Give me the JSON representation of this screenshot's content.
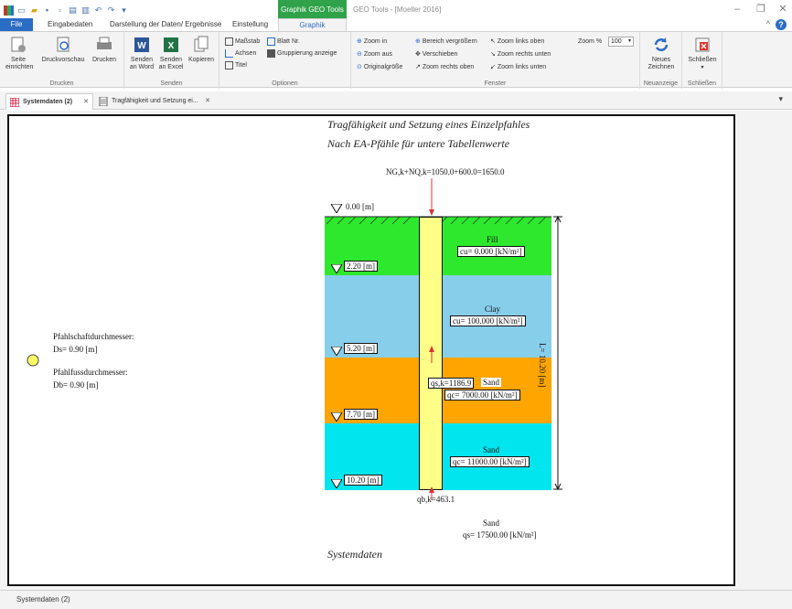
{
  "window": {
    "title": "GEO Tools - [Moeller 2016]",
    "context_tab": "Graphik GEO Tools"
  },
  "ribbon_tabs": [
    "File",
    "Eingabedaten",
    "Darstellung der Daten/ Ergebnisse",
    "Einstellung",
    "Graphik"
  ],
  "ribbon": {
    "drucken": {
      "label": "Drucken",
      "seite": "Seite\neinrichten",
      "druckvorschau": "Druckvorschau",
      "drucken": "Drucken"
    },
    "senden": {
      "label": "Senden",
      "word": "Senden\nan Word",
      "excel": "Senden\nan Excel",
      "kopieren": "Kopieren"
    },
    "optionen": {
      "label": "Optionen",
      "massstab": "Maßstab",
      "blatt": "Blatt Nr.",
      "achsen": "Achsen",
      "gruppierung": "Gruppierung anzeige",
      "titel": "Titel"
    },
    "fenster": {
      "label": "Fenster",
      "zoom_in": "Zoom in",
      "zoom_aus": "Zoom aus",
      "original": "Originalgröße",
      "bereich": "Bereich vergrößern",
      "verschieben": "Verschieben",
      "zoom_ro": "Zoom rechts oben",
      "zoom_lo": "Zoom links oben",
      "zoom_ru": "Zoom rechts unten",
      "zoom_lu": "Zoom links unten",
      "zoom_pct_label": "Zoom %",
      "zoom_pct_value": "100"
    },
    "neuanzeige": {
      "label": "Neuanzeige",
      "neu": "Neues\nZeichnen"
    },
    "schliessen": {
      "label": "Schließen",
      "btn": "Schließen"
    }
  },
  "doc_tabs": [
    "Systemdaten (2)",
    "Tragfähigkeit und Setzung ei..."
  ],
  "status": "Systemdaten (2)",
  "drawing": {
    "title1": "Tragfähigkeit und Setzung eines Einzelpfahles",
    "title2": "Nach EA-Pfähle für untere Tabellenwerte",
    "footer": "Systemdaten",
    "load_label": "NG,k+NQ,k=1050.0+600.0=1650.0",
    "pile_info": {
      "shaft_label": "Pfahlschaftdurchmesser:",
      "shaft_value": "Ds= 0.90 [m]",
      "foot_label": "Pfahlfussdurchmesser:",
      "foot_value": "Db= 0.90 [m]"
    },
    "depths": [
      "0.00 [m]",
      "2.20 [m]",
      "5.20 [m]",
      "7.70 [m]",
      "10.20 [m]"
    ],
    "layers": [
      {
        "name": "Fill",
        "param": "cu= 0.000 [kN/m²]",
        "color": "#2ee82e"
      },
      {
        "name": "Clay",
        "param": "cu= 100.000 [kN/m²]",
        "color": "#87ceeb"
      },
      {
        "name": "Sand",
        "param": "qc= 7000.00 [kN/m²]",
        "color": "#ffa500"
      },
      {
        "name": "Sand",
        "param": "qc= 11000.00 [kN/m²]",
        "color": "#00e5ee"
      }
    ],
    "qs_label": "qs,k=1186.9",
    "qb_label": "qb,k=463.1",
    "base_layer": {
      "name": "Sand",
      "param": "qs= 17500.00 [kN/m²]"
    },
    "length_label": "L= 10.20 [m]",
    "pile_color": "#ffff88",
    "pile_circle_color": "#ffff66"
  }
}
